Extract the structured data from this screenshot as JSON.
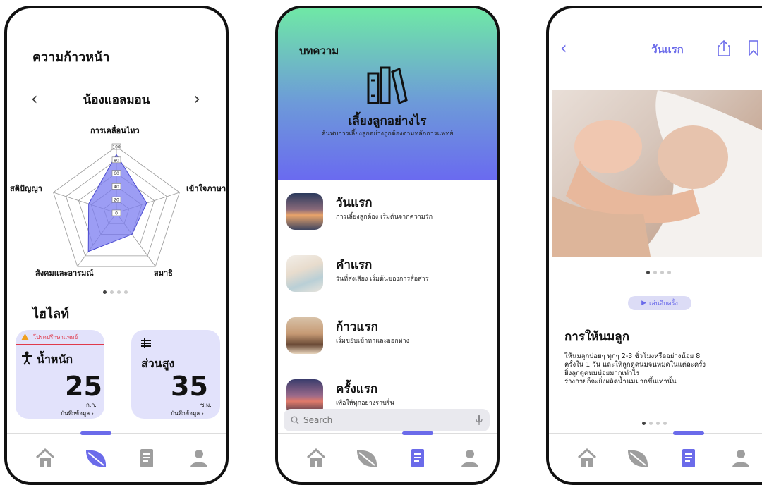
{
  "colors": {
    "accent": "#6b6bea",
    "radar_fill": "#7b7cf0",
    "warning": "#e03a4c",
    "card_bg": "#e2e2fb",
    "tab_inactive": "#9e9e9e"
  },
  "tabbar": {
    "items": [
      {
        "icon": "home-icon"
      },
      {
        "icon": "leaf-icon"
      },
      {
        "icon": "article-icon"
      },
      {
        "icon": "profile-icon"
      }
    ]
  },
  "progress": {
    "title": "ความก้าวหน้า",
    "child_name": "น้องแอลมอน",
    "radar": {
      "axes": [
        "การเคลื่อนไหว",
        "เข้าใจภาษา",
        "สมาธิ",
        "สังคมและอารมณ์",
        "สติปัญญา"
      ],
      "ticks": [
        "0",
        "20",
        "40",
        "60",
        "80",
        "100"
      ],
      "values": [
        88,
        48,
        40,
        72,
        44
      ]
    },
    "highlight_title": "ไฮไลท์",
    "weight_card": {
      "warning": "โปรดปรึกษาแพทย์",
      "label": "น้ำหนัก",
      "value": "25",
      "unit": "ก.ก.",
      "record": "บันทึกข้อมูล"
    },
    "height_card": {
      "label": "ส่วนสูง",
      "value": "35",
      "unit": "ซ.ม.",
      "record": "บันทึกข้อมูล"
    }
  },
  "articles": {
    "title": "บทความ",
    "hero_heading": "เลี้ยงลูกอย่างไร",
    "hero_sub": "ค้นพบการเลี้ยงลูกอย่างถูกต้องตามหลักการแพทย์",
    "items": [
      {
        "title": "วันแรก",
        "desc": "การเลี้ยงลูกต้อง เริ่มต้นจากความรัก"
      },
      {
        "title": "คำแรก",
        "desc": "วันที่ส่งเสียง เริ่มต้นของการสื่อสาร"
      },
      {
        "title": "ก้าวแรก",
        "desc": "เริ่มขยับเข้าหาและออกห่าง"
      },
      {
        "title": "ครั้งแรก",
        "desc": "เพื่อให้ทุกอย่างราบรื่น"
      }
    ],
    "search_placeholder": "Search"
  },
  "detail": {
    "title": "วันแรก",
    "play_label": "เล่นอีกครั้ง",
    "heading": "การให้นมลูก",
    "body_lines": [
      "ให้นมลูกบ่อยๆ ทุกๆ 2-3 ชั่วโมงหรืออย่างน้อย 8",
      "ครั้งใน 1 วัน และให้ลูกดูดนมจนหมดในแต่ละครั้ง",
      "ยิ่งลูกดูดนมบ่อยมากเท่าไร",
      "ร่างกายก็จะยิ่งผลิตน้ำนมมากขึ้นเท่านั้น"
    ]
  }
}
